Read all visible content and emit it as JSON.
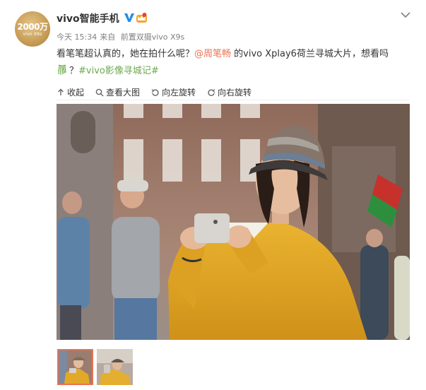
{
  "account": {
    "name": "vivo智能手机",
    "avatar_number": "2000万",
    "avatar_sub": "vivo X9s",
    "verified_icon": "blue-v-verified-icon",
    "member_icon": "crown-badge-icon"
  },
  "meta": {
    "time": "今天 15:34",
    "source_prefix": "来自",
    "source": "前置双摄vivo X9s"
  },
  "post": {
    "text_1": "看笔笔超认真的，她在拍什么呢？",
    "mention": "@周笔畅",
    "text_2": " 的vivo Xplay6荷兰寻城大片，想看吗",
    "text_3": "？",
    "hashtag": "#vivo影像寻城记#"
  },
  "toolbar": {
    "collapse": "收起",
    "view_large": "查看大图",
    "rotate_left": "向左旋转",
    "rotate_right": "向右旋转"
  },
  "colors": {
    "link": "#eb7350",
    "hashtag": "#6ca94f",
    "meta": "#808080",
    "verify_blue": "#1e8de4",
    "jacket": "#e3a826"
  },
  "thumbnails": {
    "count": 2,
    "selected": 1
  }
}
